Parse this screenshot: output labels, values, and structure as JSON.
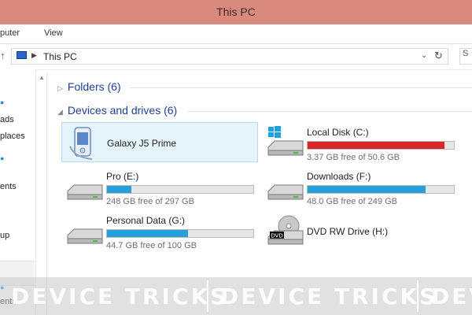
{
  "window": {
    "title": "This PC"
  },
  "ribbon": {
    "tabs": [
      "puter",
      "View"
    ]
  },
  "address": {
    "crumb": "This PC"
  },
  "nav": {
    "items": [
      "ads",
      "places",
      "ents",
      "up",
      "ents"
    ]
  },
  "groups": {
    "folders": "Folders (6)",
    "devices": "Devices and drives (6)"
  },
  "devices": [
    {
      "name": "Galaxy J5 Prime",
      "icon": "phone-icon"
    },
    {
      "name": "Local Disk (C:)",
      "free": "3.37 GB free of 50.6 GB",
      "used_fraction": 0.933,
      "critical": true,
      "icon": "windows-drive-icon"
    },
    {
      "name": "Pro (E:)",
      "free": "248 GB free of 297 GB",
      "used_fraction": 0.165,
      "icon": "drive-icon"
    },
    {
      "name": "Downloads (F:)",
      "free": "48.0 GB free of 249 GB",
      "used_fraction": 0.807,
      "icon": "drive-icon"
    },
    {
      "name": "Personal Data (G:)",
      "free": "44.7 GB free of 100 GB",
      "used_fraction": 0.553,
      "icon": "drive-icon"
    },
    {
      "name": "DVD RW Drive (H:)",
      "icon": "dvd-drive-icon",
      "badge": "DVD"
    }
  ],
  "watermark": {
    "text": "DEVICE TRICKS",
    "text_partial": "DEV"
  },
  "colors": {
    "bar_fill": "#26a0da",
    "bar_critical": "#da2626",
    "title_bar": "#d98a7c",
    "group_head": "#1e3f94"
  }
}
